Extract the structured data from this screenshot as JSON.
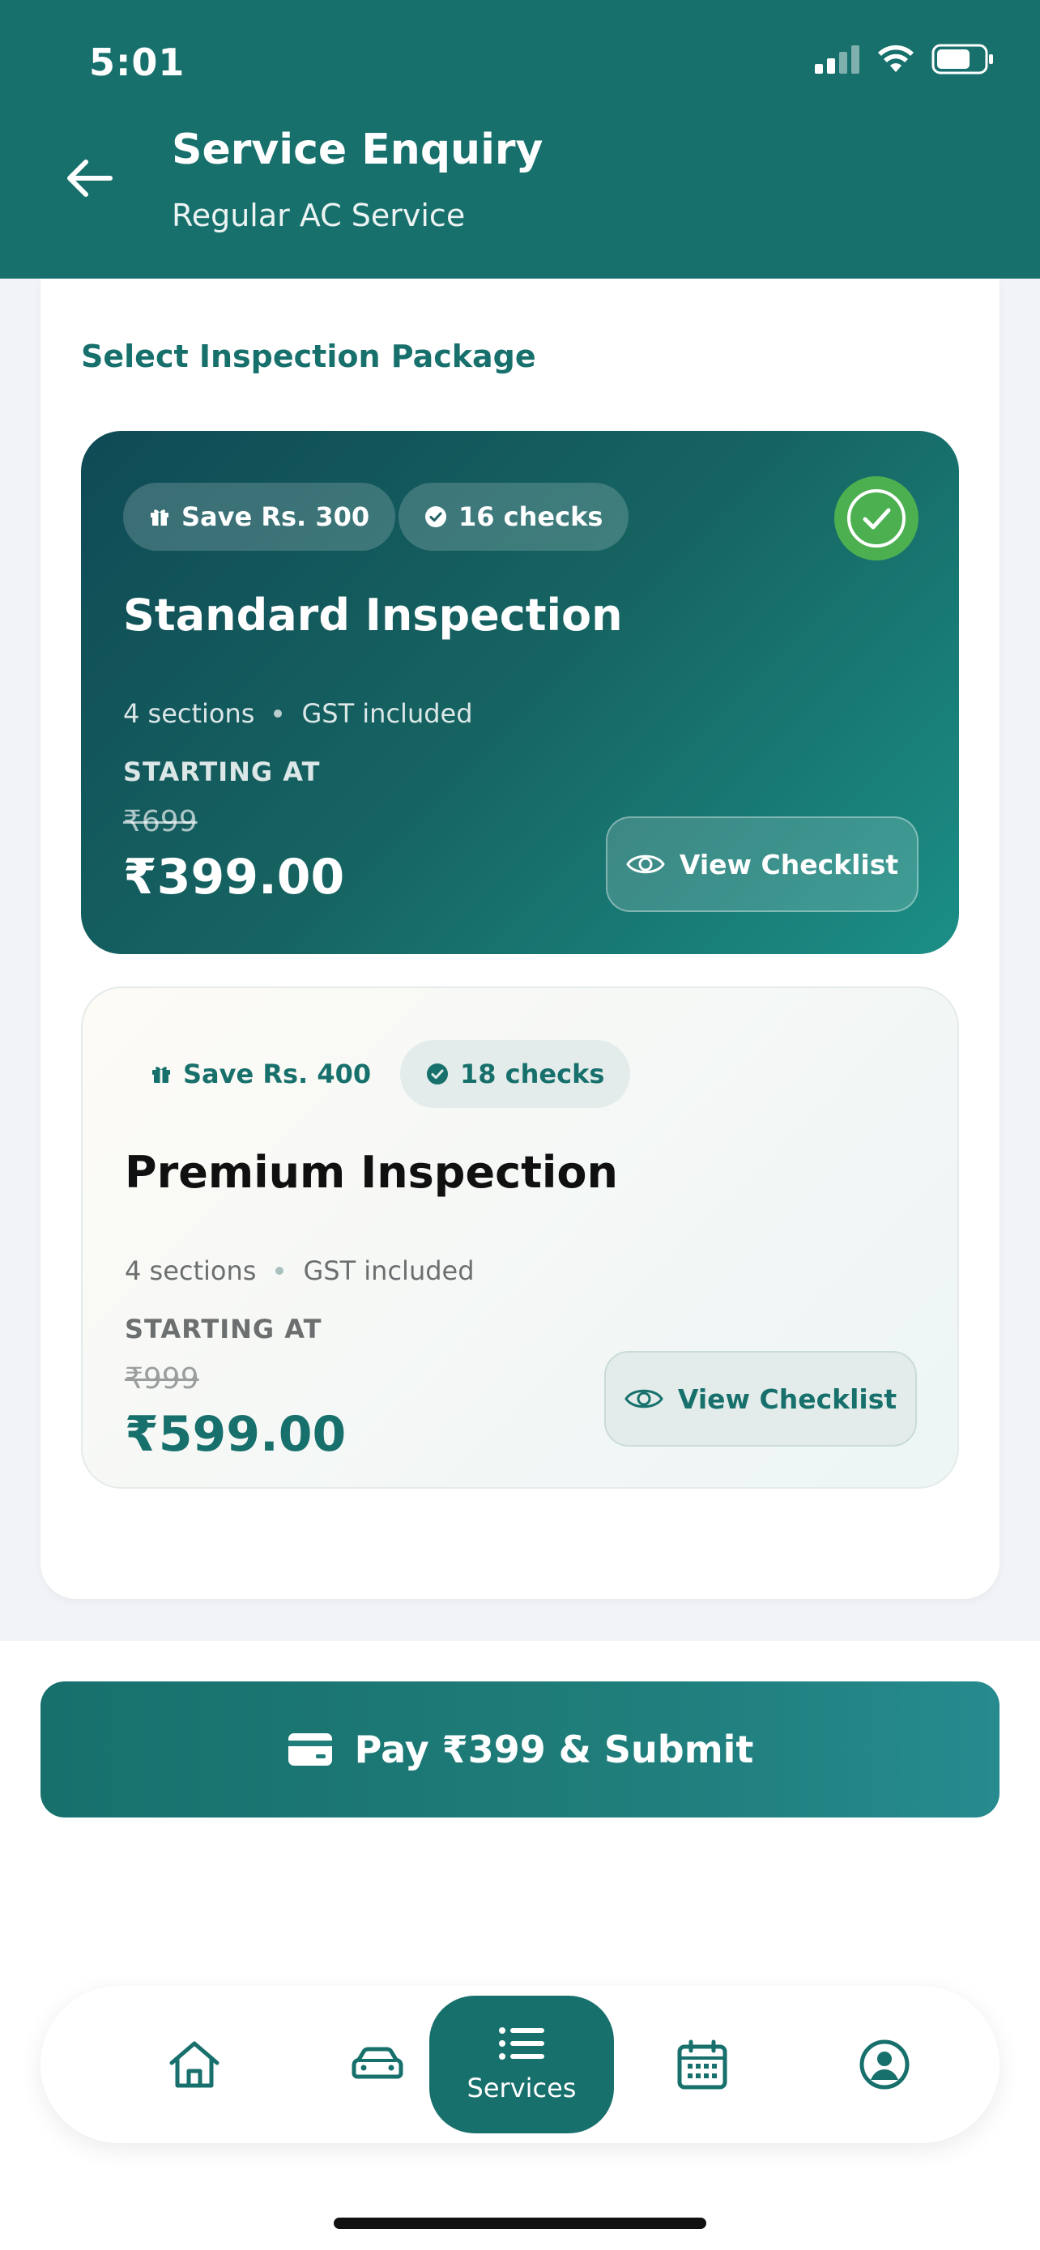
{
  "status_bar": {
    "time": "5:01"
  },
  "header": {
    "title": "Service Enquiry",
    "subtitle": "Regular AC Service",
    "back_icon": "arrow-left-icon"
  },
  "section_title": "Select Inspection Package",
  "packages": [
    {
      "save_label": "Save Rs. 300",
      "checks_label": "16 checks",
      "name": "Standard Inspection",
      "sections": "4 sections",
      "gst": "GST included",
      "starting_label": "STARTING AT",
      "old_price": "₹699",
      "price": "₹399.00",
      "view_label": "View Checklist",
      "selected": true
    },
    {
      "save_label": "Save Rs. 400",
      "checks_label": "18 checks",
      "name": "Premium Inspection",
      "sections": "4 sections",
      "gst": "GST included",
      "starting_label": "STARTING AT",
      "old_price": "₹999",
      "price": "₹599.00",
      "view_label": "View Checklist",
      "selected": false
    }
  ],
  "pay_button": {
    "label": "Pay ₹399 & Submit",
    "icon": "card-icon"
  },
  "bottom_nav": {
    "items": [
      {
        "icon": "home-icon"
      },
      {
        "icon": "car-icon"
      },
      {
        "icon": "list-icon",
        "label": "Services",
        "active": true
      },
      {
        "icon": "calendar-icon"
      },
      {
        "icon": "profile-icon"
      }
    ]
  },
  "colors": {
    "primary": "#17706c",
    "selected_badge": "#4caf50"
  }
}
